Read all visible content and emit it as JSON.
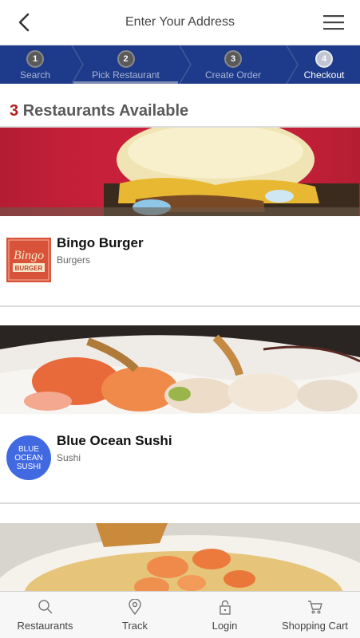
{
  "header": {
    "title": "Enter Your Address",
    "back_icon": "chevron-left-icon",
    "menu_icon": "hamburger-menu-icon"
  },
  "steps": [
    {
      "num": "1",
      "label": "Search"
    },
    {
      "num": "2",
      "label": "Pick Restaurant"
    },
    {
      "num": "3",
      "label": "Create Order"
    },
    {
      "num": "4",
      "label": "Checkout"
    }
  ],
  "results": {
    "count": "3",
    "label": "Restaurants Available"
  },
  "restaurants": [
    {
      "name": "Bingo Burger",
      "cuisine": "Burgers",
      "logo_text": "Bingo",
      "logo_sub": "BURGER"
    },
    {
      "name": "Blue Ocean Sushi",
      "cuisine": "Sushi",
      "logo_line1": "BLUE",
      "logo_line2": "OCEAN",
      "logo_line3": "SUSHI"
    },
    {
      "name": "",
      "cuisine": ""
    }
  ],
  "bottom_nav": [
    {
      "label": "Restaurants",
      "icon": "search-icon"
    },
    {
      "label": "Track",
      "icon": "location-pin-icon"
    },
    {
      "label": "Login",
      "icon": "lock-icon"
    },
    {
      "label": "Shopping Cart",
      "icon": "cart-icon"
    }
  ],
  "colors": {
    "step_bar": "#1e3a8a",
    "count_accent": "#b0201d",
    "bingo_logo_bg": "#d9533a",
    "ocean_logo_bg": "#4169e1"
  }
}
